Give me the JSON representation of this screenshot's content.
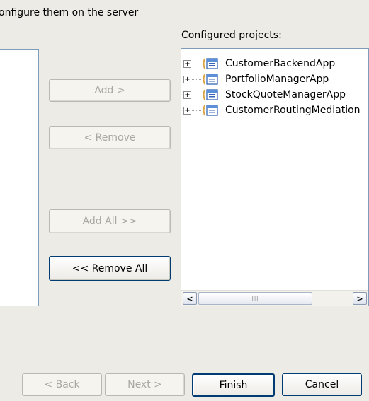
{
  "instruction": "onfigure them on the server",
  "configured_projects": {
    "label": "Configured projects:",
    "items": [
      {
        "label": "CustomerBackendApp",
        "icon": "project-folder-icon"
      },
      {
        "label": "PortfolioManagerApp",
        "icon": "project-folder-icon"
      },
      {
        "label": "StockQuoteManagerApp",
        "icon": "project-folder-icon"
      },
      {
        "label": "CustomerRoutingMediation",
        "icon": "project-folder-icon"
      }
    ],
    "expander_symbol": "+",
    "scroll_left": "<",
    "scroll_right": ">",
    "thumb_grip": "III"
  },
  "transfer_buttons": {
    "add": "Add >",
    "remove": "< Remove",
    "add_all": "Add All >>",
    "remove_all": "<< Remove All"
  },
  "wizard_buttons": {
    "back": "< Back",
    "next": "Next >",
    "finish": "Finish",
    "cancel": "Cancel"
  },
  "colors": {
    "background": "#ecebe6",
    "list_border": "#7f9db9",
    "disabled_text": "#a9a8a2",
    "button_border": "#003c74"
  }
}
